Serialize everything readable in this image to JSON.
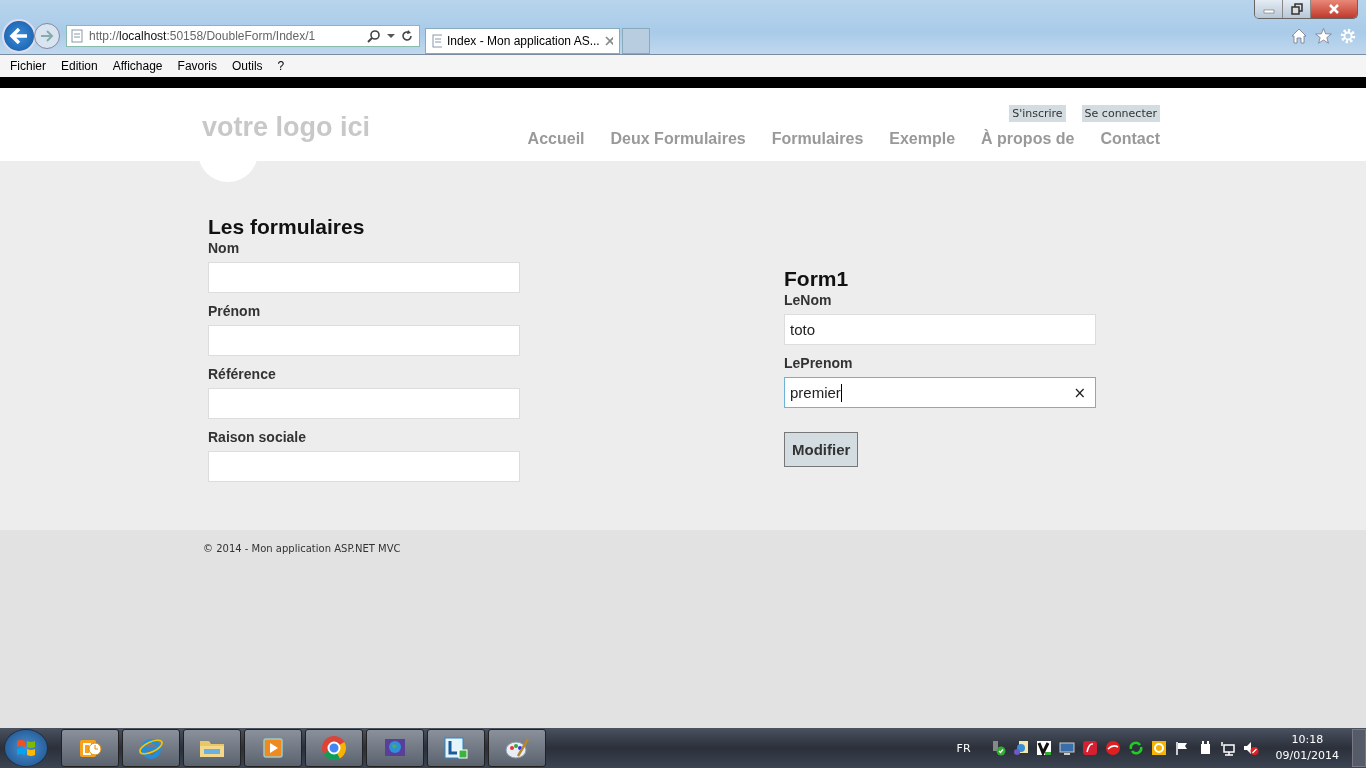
{
  "browser": {
    "address": "http://**localhost**:50158/DoubleForm/Index/1",
    "tab": {
      "title": "Index - Mon application AS...",
      "selected": true
    },
    "menu": [
      "Fichier",
      "Edition",
      "Affichage",
      "Favoris",
      "Outils",
      "?"
    ]
  },
  "site": {
    "logo": "votre logo ici",
    "auth_links": [
      "S'inscrire",
      "Se connecter"
    ],
    "nav": [
      "Accueil",
      "Deux Formulaires",
      "Formulaires",
      "Exemple",
      "À propos de",
      "Contact"
    ]
  },
  "left_form": {
    "title": "Les formulaires",
    "fields": [
      {
        "label": "Nom",
        "focused": false
      },
      {
        "label": "Prénom",
        "focused": false
      },
      {
        "label": "Référence",
        "focused": false
      },
      {
        "label": "Raison sociale",
        "focused": false
      }
    ]
  },
  "right_form": {
    "title": "Form1",
    "fields": [
      {
        "label": "LeNom",
        "value": "toto",
        "focused": false
      },
      {
        "label": "LePrenom",
        "value": "premier",
        "focused": true,
        "clear": "×"
      }
    ],
    "button": "Modifier"
  },
  "footer": "© 2014 - Mon application ASP.NET MVC",
  "taskbar": {
    "apps": [
      {
        "kind": "mail"
      },
      {
        "kind": "browser"
      },
      {
        "kind": "folder"
      },
      {
        "kind": "media"
      },
      {
        "kind": "ring"
      },
      {
        "kind": "globe"
      },
      {
        "kind": "lync"
      },
      {
        "kind": "paint"
      }
    ],
    "language": "FR",
    "time": "10:18",
    "date": "09/01/2014"
  }
}
